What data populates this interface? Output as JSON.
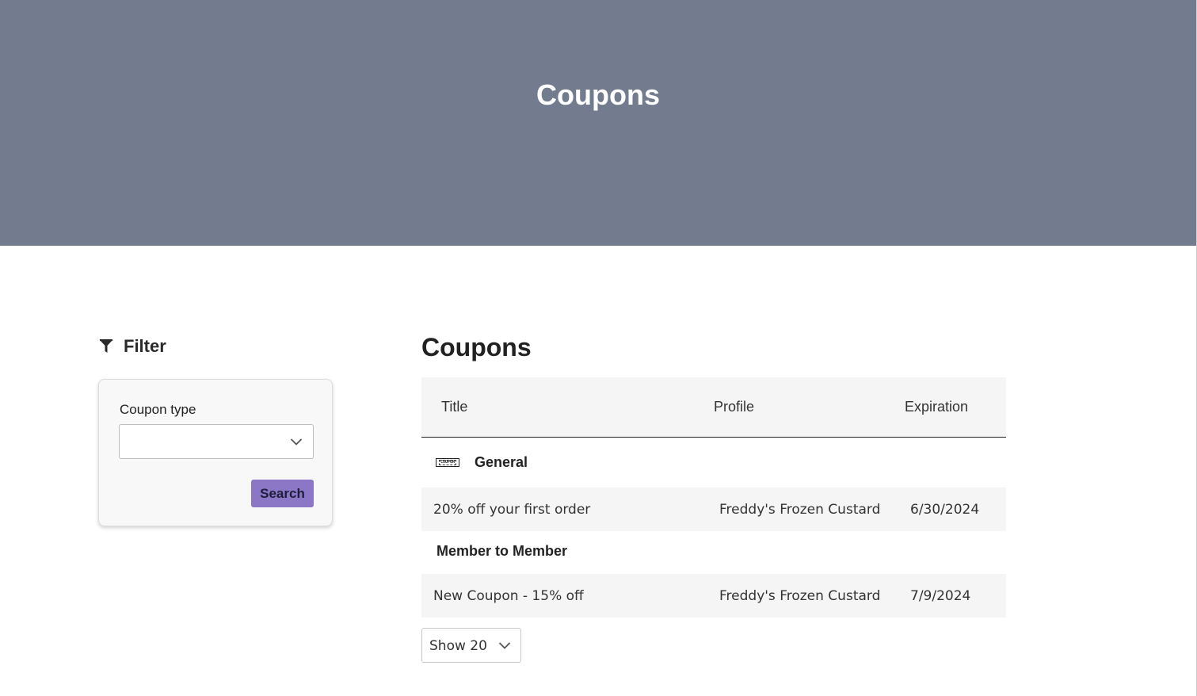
{
  "hero": {
    "title": "Coupons"
  },
  "filter": {
    "title": "Filter",
    "coupon_type_label": "Coupon type",
    "coupon_type_value": "",
    "search_label": "Search"
  },
  "list": {
    "title": "Coupons",
    "columns": {
      "title": "Title",
      "profile": "Profile",
      "expiration": "Expiration"
    },
    "groups": [
      {
        "name": "General",
        "icon_text": "COUPON",
        "rows": [
          {
            "title": "20% off your first order",
            "profile": "Freddy's Frozen Custard",
            "expiration": "6/30/2024"
          }
        ]
      },
      {
        "name": "Member to Member",
        "rows": [
          {
            "title": "New Coupon - 15% off",
            "profile": "Freddy's Frozen Custard",
            "expiration": "7/9/2024"
          }
        ]
      }
    ]
  },
  "pagination": {
    "page_size_label": "Show 20"
  },
  "colors": {
    "hero_bg": "#727c8e",
    "button_bg": "#8c77c6",
    "row_bg": "#f5f5f5"
  },
  "icons": {
    "filter": "filter-icon",
    "chevron": "chevron-down-icon",
    "coupon": "coupon-icon"
  }
}
